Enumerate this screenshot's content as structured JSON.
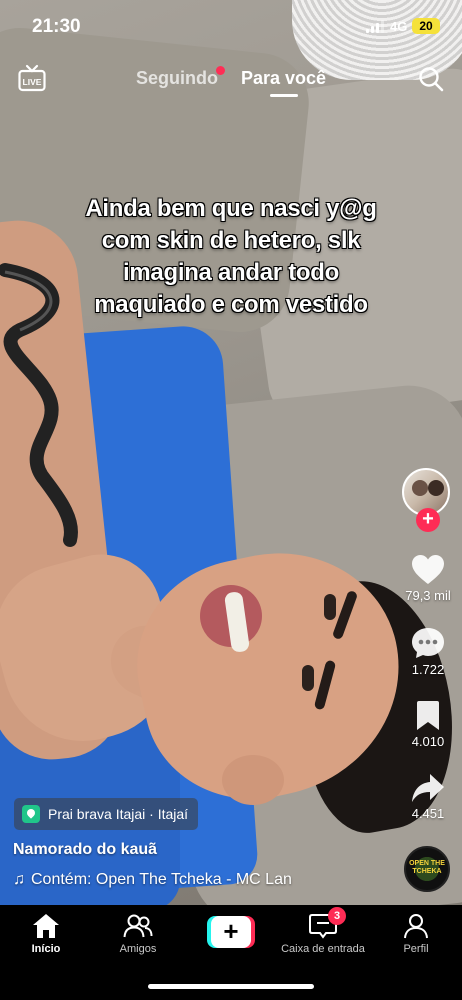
{
  "status_bar": {
    "time": "21:30",
    "network": "4G",
    "battery": "20"
  },
  "top_nav": {
    "live_icon": "live-tv-icon",
    "tabs": [
      {
        "label": "Seguindo",
        "has_dot": true
      },
      {
        "label": "Para você",
        "active": true
      }
    ],
    "search_icon": "search-icon"
  },
  "caption": {
    "lines": [
      "Ainda bem que nasci y@g",
      "com skin de hetero, slk",
      "imagina andar todo",
      "maquiado e com vestido"
    ]
  },
  "rail": {
    "likes": "79,3 mil",
    "comments": "1.722",
    "saves": "4.010",
    "shares": "4.451",
    "follow_symbol": "+"
  },
  "music_disc": {
    "text": "OPEN THE TCHEKA"
  },
  "location": {
    "label": "Prai brava Itajai · Itajaí"
  },
  "author": "Namorado do kauã",
  "sound": {
    "label": "Contém: Open The Tcheka - MC Lan"
  },
  "tabbar": {
    "items": [
      {
        "label": "Início",
        "icon": "home-icon",
        "active": true
      },
      {
        "label": "Amigos",
        "icon": "friends-icon"
      },
      {
        "label": "",
        "icon": "plus-icon"
      },
      {
        "label": "Caixa de entrada",
        "icon": "inbox-icon",
        "badge": "3"
      },
      {
        "label": "Perfil",
        "icon": "profile-icon"
      }
    ]
  },
  "colors": {
    "accent": "#fe2c55",
    "cyan": "#25f4ee",
    "location_green": "#20c58a"
  }
}
